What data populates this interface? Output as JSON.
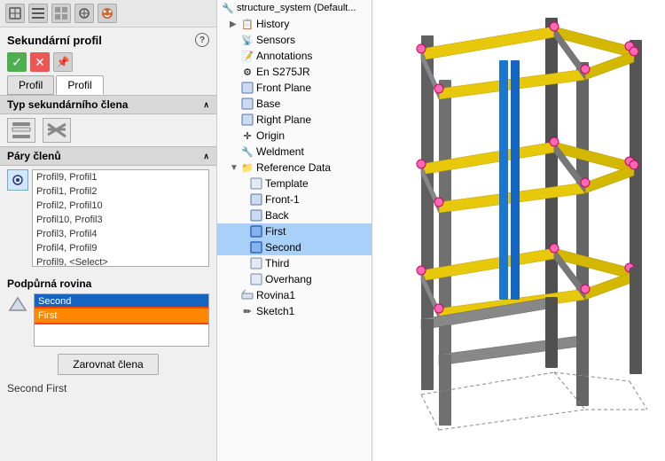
{
  "leftPanel": {
    "title": "Sekundární profil",
    "tabs": [
      "Profil",
      "Profil"
    ],
    "sections": {
      "typSection": "Typ sekundárního člena",
      "pairsSection": "Páry členů",
      "pairs": [
        "Profil9, Profil1",
        "Profil1, Profil2",
        "Profil2, Profil10",
        "Profil10, Profil3",
        "Profil3, Profil4",
        "Profil4, Profil9",
        "Profil9, <Select>"
      ],
      "rovSection": "Podpůrná rovina",
      "rovItems": [
        "Second",
        "First"
      ],
      "rovSelectedIdx": 0,
      "rovHighlightIdx": 1
    },
    "buttons": {
      "zarovnat": "Zarovnat člena"
    }
  },
  "tree": {
    "rootLabel": "structure_system (Default...",
    "items": [
      {
        "label": "History",
        "indent": 1,
        "icon": "📋",
        "expand": "▶"
      },
      {
        "label": "Sensors",
        "indent": 1,
        "icon": "📡",
        "expand": ""
      },
      {
        "label": "Annotations",
        "indent": 1,
        "icon": "📝",
        "expand": ""
      },
      {
        "label": "En S275JR",
        "indent": 1,
        "icon": "⚙",
        "expand": ""
      },
      {
        "label": "Front Plane",
        "indent": 1,
        "icon": "▭",
        "expand": ""
      },
      {
        "label": "Base",
        "indent": 1,
        "icon": "▭",
        "expand": ""
      },
      {
        "label": "Right Plane",
        "indent": 1,
        "icon": "▭",
        "expand": ""
      },
      {
        "label": "Origin",
        "indent": 1,
        "icon": "✛",
        "expand": ""
      },
      {
        "label": "Weldment",
        "indent": 1,
        "icon": "🔧",
        "expand": ""
      },
      {
        "label": "Reference Data",
        "indent": 1,
        "icon": "📁",
        "expand": "▼",
        "expanded": true
      },
      {
        "label": "Template",
        "indent": 2,
        "icon": "▭",
        "expand": ""
      },
      {
        "label": "Front-1",
        "indent": 2,
        "icon": "▭",
        "expand": ""
      },
      {
        "label": "Back",
        "indent": 2,
        "icon": "▭",
        "expand": ""
      },
      {
        "label": "First",
        "indent": 2,
        "icon": "▭",
        "expand": "",
        "highlighted": true
      },
      {
        "label": "Second",
        "indent": 2,
        "icon": "▭",
        "expand": "",
        "highlighted": true
      },
      {
        "label": "Third",
        "indent": 2,
        "icon": "▭",
        "expand": ""
      },
      {
        "label": "Overhang",
        "indent": 2,
        "icon": "▭",
        "expand": ""
      },
      {
        "label": "Rovina1",
        "indent": 1,
        "icon": "▭",
        "expand": ""
      },
      {
        "label": "Sketch1",
        "indent": 1,
        "icon": "✏",
        "expand": ""
      }
    ]
  },
  "secondFirstLabel": "Second First",
  "icons": {
    "check": "✓",
    "cross": "✕",
    "pin": "📌",
    "help": "?",
    "chevronDown": "∧",
    "chevronRight": ">"
  }
}
